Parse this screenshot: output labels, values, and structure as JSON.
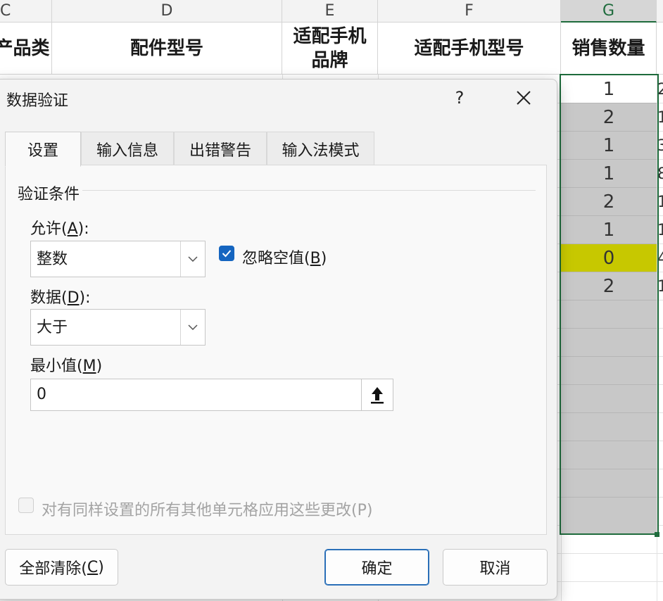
{
  "sheet": {
    "columns": [
      "C",
      "D",
      "E",
      "F",
      "G"
    ],
    "headers": [
      "产品类",
      "配件型号",
      "适配手机品牌",
      "适配手机型号",
      "销售数量"
    ],
    "g_values": [
      "1",
      "2",
      "1",
      "1",
      "2",
      "1",
      "0",
      "2"
    ],
    "h_partial": [
      "2",
      "1",
      "3",
      "8",
      "1",
      "1",
      "4",
      "1"
    ],
    "colors": {
      "selection": "#1e6b3c",
      "highlight": "#c7c800",
      "selected_fill": "#c8c8c8"
    }
  },
  "dialog": {
    "title": "数据验证",
    "help_label": "?",
    "tabs": [
      "设置",
      "输入信息",
      "出错警告",
      "输入法模式"
    ],
    "active_tab": "设置",
    "group_title": "验证条件",
    "allow": {
      "label_prefix": "允许(",
      "key": "A",
      "label_suffix": "):",
      "value": "整数"
    },
    "ignore_blank": {
      "label_prefix": "忽略空值(",
      "key": "B",
      "label_suffix": ")",
      "checked": true
    },
    "data": {
      "label_prefix": "数据(",
      "key": "D",
      "label_suffix": "):",
      "value": "大于"
    },
    "minimum": {
      "label_prefix": "最小值(",
      "key": "M",
      "label_suffix": ")",
      "value": "0"
    },
    "apply_all": {
      "label": "对有同样设置的所有其他单元格应用这些更改(P)",
      "checked": false,
      "enabled": false
    },
    "buttons": {
      "clear_prefix": "全部清除(",
      "clear_key": "C",
      "clear_suffix": ")",
      "ok": "确定",
      "cancel": "取消"
    },
    "icons": [
      "question-icon",
      "close-icon",
      "chevron-down-icon",
      "checkmark-icon",
      "range-collapse-icon"
    ],
    "colors": {
      "accent": "#1565c0"
    }
  }
}
